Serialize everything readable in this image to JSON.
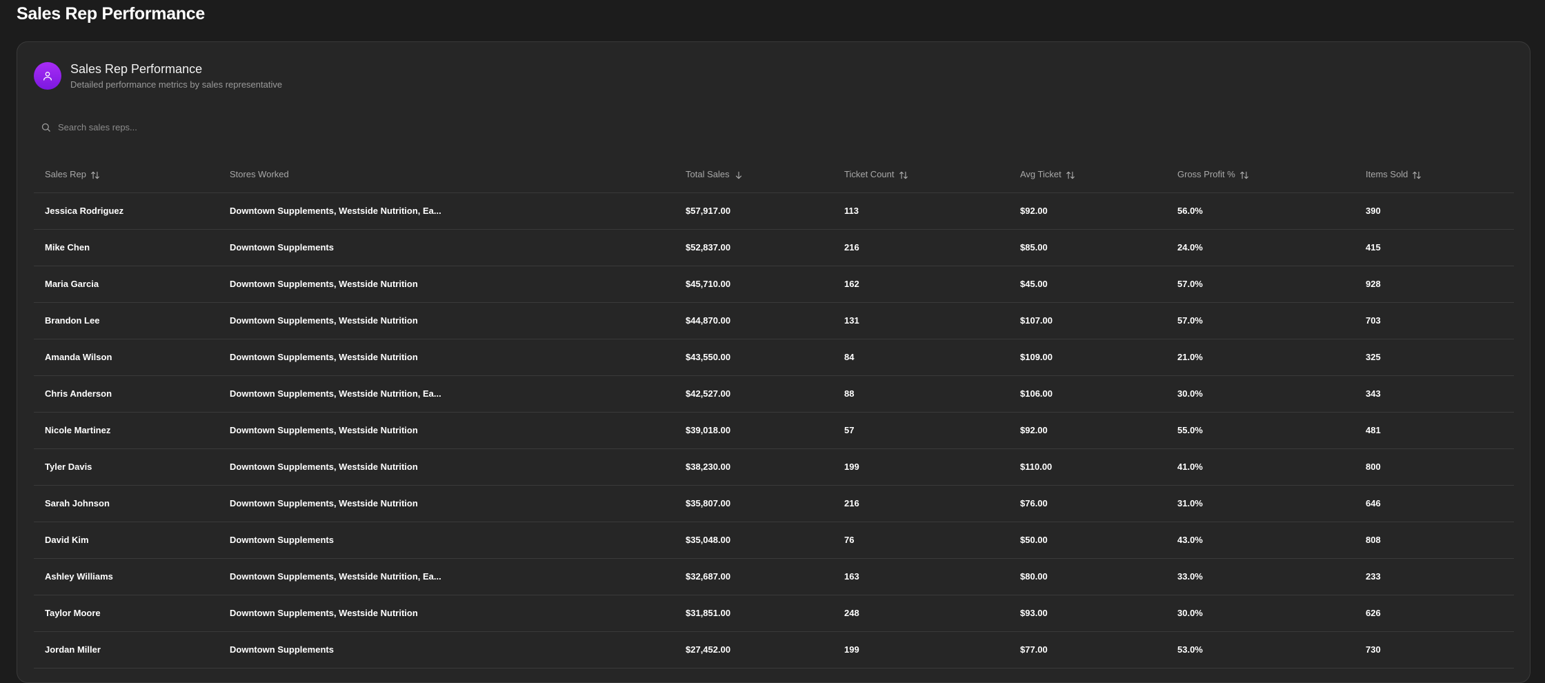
{
  "page": {
    "title": "Sales Rep Performance"
  },
  "card": {
    "title": "Sales Rep Performance",
    "subtitle": "Detailed performance metrics by sales representative",
    "icon": "user-icon",
    "accent": "#9b24f0"
  },
  "search": {
    "placeholder": "Search sales reps...",
    "value": ""
  },
  "table": {
    "columns": [
      {
        "label": "Sales Rep",
        "sort": "unsorted"
      },
      {
        "label": "Stores Worked",
        "sort": "none"
      },
      {
        "label": "Total Sales",
        "sort": "descending"
      },
      {
        "label": "Ticket Count",
        "sort": "unsorted"
      },
      {
        "label": "Avg Ticket",
        "sort": "unsorted"
      },
      {
        "label": "Gross Profit %",
        "sort": "unsorted"
      },
      {
        "label": "Items Sold",
        "sort": "unsorted"
      }
    ],
    "rows": [
      {
        "rep": "Jessica Rodriguez",
        "stores": "Downtown Supplements, Westside Nutrition, Ea...",
        "sales": "$57,917.00",
        "tickets": "113",
        "avg": "$92.00",
        "gp": "56.0%",
        "items": "390"
      },
      {
        "rep": "Mike Chen",
        "stores": "Downtown Supplements",
        "sales": "$52,837.00",
        "tickets": "216",
        "avg": "$85.00",
        "gp": "24.0%",
        "items": "415"
      },
      {
        "rep": "Maria Garcia",
        "stores": "Downtown Supplements, Westside Nutrition",
        "sales": "$45,710.00",
        "tickets": "162",
        "avg": "$45.00",
        "gp": "57.0%",
        "items": "928"
      },
      {
        "rep": "Brandon Lee",
        "stores": "Downtown Supplements, Westside Nutrition",
        "sales": "$44,870.00",
        "tickets": "131",
        "avg": "$107.00",
        "gp": "57.0%",
        "items": "703"
      },
      {
        "rep": "Amanda Wilson",
        "stores": "Downtown Supplements, Westside Nutrition",
        "sales": "$43,550.00",
        "tickets": "84",
        "avg": "$109.00",
        "gp": "21.0%",
        "items": "325"
      },
      {
        "rep": "Chris Anderson",
        "stores": "Downtown Supplements, Westside Nutrition, Ea...",
        "sales": "$42,527.00",
        "tickets": "88",
        "avg": "$106.00",
        "gp": "30.0%",
        "items": "343"
      },
      {
        "rep": "Nicole Martinez",
        "stores": "Downtown Supplements, Westside Nutrition",
        "sales": "$39,018.00",
        "tickets": "57",
        "avg": "$92.00",
        "gp": "55.0%",
        "items": "481"
      },
      {
        "rep": "Tyler Davis",
        "stores": "Downtown Supplements, Westside Nutrition",
        "sales": "$38,230.00",
        "tickets": "199",
        "avg": "$110.00",
        "gp": "41.0%",
        "items": "800"
      },
      {
        "rep": "Sarah Johnson",
        "stores": "Downtown Supplements, Westside Nutrition",
        "sales": "$35,807.00",
        "tickets": "216",
        "avg": "$76.00",
        "gp": "31.0%",
        "items": "646"
      },
      {
        "rep": "David Kim",
        "stores": "Downtown Supplements",
        "sales": "$35,048.00",
        "tickets": "76",
        "avg": "$50.00",
        "gp": "43.0%",
        "items": "808"
      },
      {
        "rep": "Ashley Williams",
        "stores": "Downtown Supplements, Westside Nutrition, Ea...",
        "sales": "$32,687.00",
        "tickets": "163",
        "avg": "$80.00",
        "gp": "33.0%",
        "items": "233"
      },
      {
        "rep": "Taylor Moore",
        "stores": "Downtown Supplements, Westside Nutrition",
        "sales": "$31,851.00",
        "tickets": "248",
        "avg": "$93.00",
        "gp": "30.0%",
        "items": "626"
      },
      {
        "rep": "Jordan Miller",
        "stores": "Downtown Supplements",
        "sales": "$27,452.00",
        "tickets": "199",
        "avg": "$77.00",
        "gp": "53.0%",
        "items": "730"
      }
    ]
  }
}
